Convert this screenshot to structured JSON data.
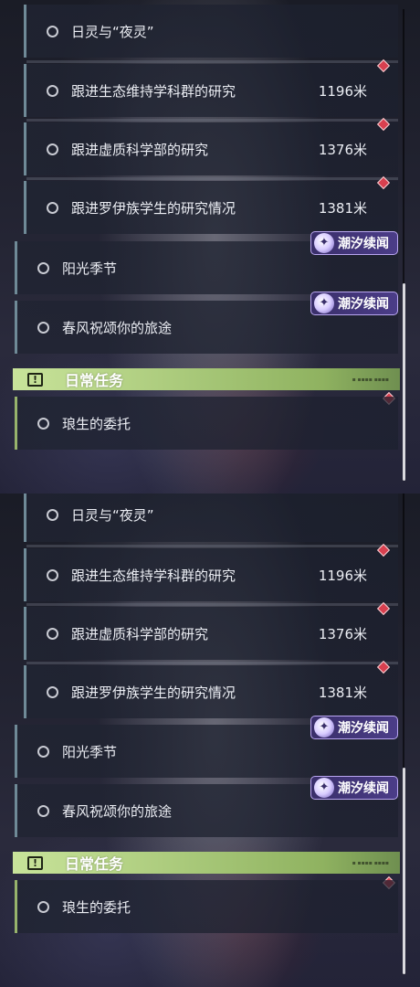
{
  "quests": {
    "q1": {
      "label": "日灵与“夜灵”"
    },
    "q2": {
      "label": "跟进生态维持学科群的研究",
      "distance": "1196米"
    },
    "q3": {
      "label": "跟进虚质科学部的研究",
      "distance": "1376米"
    },
    "q4": {
      "label": "跟进罗伊族学生的研究情况",
      "distance": "1381米"
    },
    "q5": {
      "label": "阳光季节"
    },
    "q6": {
      "label": "春风祝颂你的旅途"
    },
    "q7": {
      "label": "琅生的委托"
    }
  },
  "badge": {
    "text": "潮汐续闻",
    "icon": "tide-swirl-icon"
  },
  "daily": {
    "title": "日常任务",
    "icon": "exclamation-box-icon"
  },
  "colors": {
    "marker": "#d8404f",
    "daily_accent": "#a9c97a",
    "badge_bg": "#4b3d88",
    "quest_bar": "#6f8a97"
  }
}
